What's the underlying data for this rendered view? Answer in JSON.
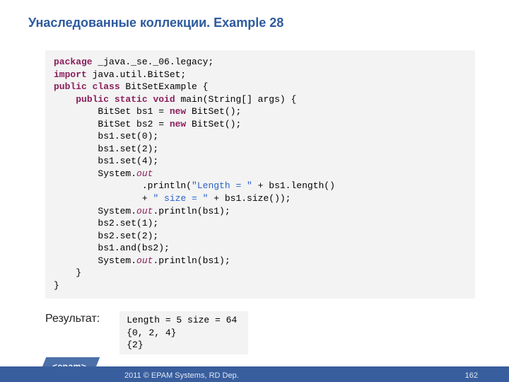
{
  "title": "Унаследованные коллекции. Example 28",
  "code": {
    "kw_package": "package",
    "pkg_name": " _java._se._06.legacy;",
    "kw_import": "import",
    "import_name": " java.util.BitSet;",
    "kw_public": "public",
    "kw_class": " class",
    "class_name": " BitSetExample {",
    "kw_public2": "public",
    "kw_static": " static",
    "kw_void": " void",
    "main_sig": " main(String[] args) {",
    "bs1_decl_a": "        BitSet bs1 = ",
    "kw_new1": "new",
    "bs1_decl_b": " BitSet();",
    "bs2_decl_a": "        BitSet bs2 = ",
    "kw_new2": "new",
    "bs2_decl_b": " BitSet();",
    "l_set0": "        bs1.set(0);",
    "l_set2": "        bs1.set(2);",
    "l_set4": "        bs1.set(4);",
    "sys_a": "        System.",
    "out": "out",
    "println_a": "                .println(",
    "str_len": "\"Length = \"",
    "println_b": " + bs1.length()",
    "plus_a": "                + ",
    "str_size": "\" size = \"",
    "plus_b": " + bs1.size());",
    "sys_b": "        System.",
    "println_bs1": ".println(bs1);",
    "l_b2set1": "        bs2.set(1);",
    "l_b2set2": "        bs2.set(2);",
    "l_and": "        bs1.and(bs2);",
    "sys_c": "        System.",
    "println_bs1b": ".println(bs1);",
    "close_main": "    }",
    "close_cls": "}"
  },
  "result_label": "Результат:",
  "result": {
    "line1": "Length = 5 size = 64",
    "line2": "{0, 2, 4}",
    "line3": "{2}"
  },
  "footer": {
    "logo": "<epam>",
    "copy": "2011 © EPAM Systems, RD Dep.",
    "page": "162"
  }
}
